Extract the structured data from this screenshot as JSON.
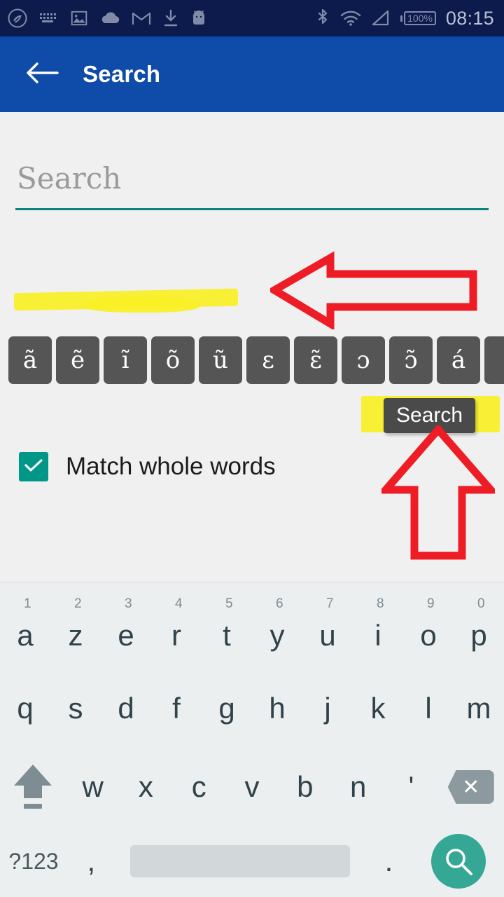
{
  "status_bar": {
    "time": "08:15",
    "battery_text": "100%",
    "left_icons": [
      {
        "name": "shazam-icon"
      },
      {
        "name": "keyboard-icon"
      },
      {
        "name": "image-icon"
      },
      {
        "name": "cloud-icon"
      },
      {
        "name": "gmail-icon"
      },
      {
        "name": "download-icon"
      },
      {
        "name": "android-icon"
      }
    ],
    "right_icons": [
      {
        "name": "bluetooth-icon"
      },
      {
        "name": "wifi-icon"
      },
      {
        "name": "signal-icon"
      },
      {
        "name": "battery-icon"
      }
    ]
  },
  "app_bar": {
    "title": "Search",
    "back_icon": "back-arrow-icon"
  },
  "search": {
    "value": "",
    "placeholder": "Search"
  },
  "special_chars": {
    "keys": [
      "ã",
      "ẽ",
      "ĩ",
      "õ",
      "ũ",
      "ɛ",
      "ɛ̃",
      "ɔ",
      "ɔ̃",
      "á",
      ""
    ]
  },
  "tooltip": {
    "label": "Search"
  },
  "checkbox": {
    "label": "Match whole words",
    "checked": true
  },
  "annotations": {
    "arrow_left": "red-left-arrow",
    "arrow_up": "red-up-arrow",
    "highlight_color": "#f9f024",
    "arrow_color": "#ee1c25"
  },
  "colors": {
    "app_bar": "#0f4ba8",
    "status_bar": "#0d1b4c",
    "accent_teal": "#009688",
    "underline": "#0a8577",
    "enter_key": "#35a795"
  },
  "keyboard": {
    "row1": [
      {
        "num": "1",
        "letter": "a"
      },
      {
        "num": "2",
        "letter": "z"
      },
      {
        "num": "3",
        "letter": "e"
      },
      {
        "num": "4",
        "letter": "r"
      },
      {
        "num": "5",
        "letter": "t"
      },
      {
        "num": "6",
        "letter": "y"
      },
      {
        "num": "7",
        "letter": "u"
      },
      {
        "num": "8",
        "letter": "i"
      },
      {
        "num": "9",
        "letter": "o"
      },
      {
        "num": "0",
        "letter": "p"
      }
    ],
    "row2": [
      "q",
      "s",
      "d",
      "f",
      "g",
      "h",
      "j",
      "k",
      "l",
      "m"
    ],
    "row3": {
      "shift": "shift-icon",
      "letters": [
        "w",
        "x",
        "c",
        "v",
        "b",
        "n",
        "'"
      ],
      "delete": "backspace-icon"
    },
    "row4": {
      "symbols": "?123",
      "comma": ",",
      "space": "",
      "period": ".",
      "enter": "search-icon"
    }
  }
}
